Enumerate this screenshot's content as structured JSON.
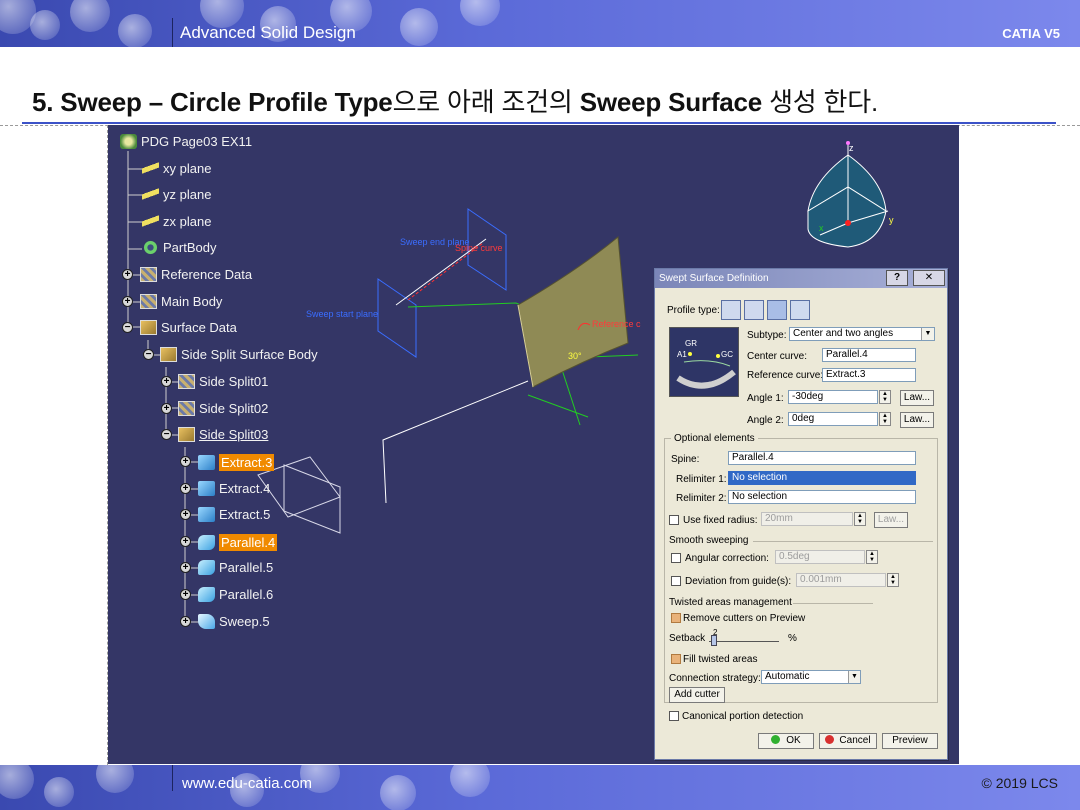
{
  "header": {
    "title": "Advanced Solid Design",
    "product": "CATIA V5"
  },
  "footer": {
    "url": "www.edu-catia.com",
    "copyright": "© 2019 LCS"
  },
  "slide": {
    "title_bold_1": "5. Sweep – Circle Profile Type",
    "title_kr_1": "으로 아래 조건의 ",
    "title_bold_2": "Sweep Surface",
    "title_kr_2": " 생성 한다."
  },
  "tree": {
    "root": "PDG Page03 EX11",
    "items": [
      {
        "label": "xy plane"
      },
      {
        "label": "yz plane"
      },
      {
        "label": "zx plane"
      },
      {
        "label": "PartBody"
      },
      {
        "label": "Reference Data"
      },
      {
        "label": "Main Body"
      },
      {
        "label": "Surface Data"
      },
      {
        "label": "Side Split Surface Body"
      },
      {
        "label": "Side Split01"
      },
      {
        "label": "Side Split02"
      },
      {
        "label": "Side Split03"
      },
      {
        "label": "Extract.3"
      },
      {
        "label": "Extract.4"
      },
      {
        "label": "Extract.5"
      },
      {
        "label": "Parallel.4"
      },
      {
        "label": "Parallel.5"
      },
      {
        "label": "Parallel.6"
      },
      {
        "label": "Sweep.5"
      }
    ]
  },
  "viewport_labels": {
    "sweep_end_plane": "Sweep end plane",
    "spine_curve": "Spine curve",
    "sweep_start_plane": "Sweep start plane",
    "reference": "Reference c",
    "angle": "30°",
    "compass_z": "z",
    "compass_y": "y",
    "compass_x": "x"
  },
  "dialog": {
    "title": "Swept Surface Definition",
    "help_button": "?",
    "close_button": "✕",
    "profile_type_label": "Profile type:",
    "subtype_label": "Subtype:",
    "subtype_value": "Center and two angles",
    "center_curve_label": "Center curve:",
    "center_curve_value": "Parallel.4",
    "reference_curve_label": "Reference curve:",
    "reference_curve_value": "Extract.3",
    "angle1_label": "Angle 1:",
    "angle1_value": "-30deg",
    "angle2_label": "Angle 2:",
    "angle2_value": "0deg",
    "law_button": "Law...",
    "preview_labels": {
      "gr": "GR",
      "gc": "GC",
      "a1": "A1"
    },
    "optional_elements": "Optional elements",
    "spine_label": "Spine:",
    "spine_value": "Parallel.4",
    "relimiter1_label": "Relimiter 1:",
    "relimiter1_value": "No selection",
    "relimiter2_label": "Relimiter 2:",
    "relimiter2_value": "No selection",
    "use_fixed_radius": "Use fixed radius:",
    "fixed_radius_value": "20mm",
    "law_button_disabled": "Law...",
    "smooth_sweeping": "Smooth sweeping",
    "angular_correction": "Angular correction:",
    "angular_correction_value": "0.5deg",
    "deviation_from_guides": "Deviation from guide(s):",
    "deviation_value": "0.001mm",
    "twisted_areas": "Twisted areas management",
    "remove_cutters": "Remove cutters on Preview",
    "setback_label": "Setback",
    "setback_value": "2",
    "setback_unit": "%",
    "fill_twisted": "Fill twisted areas",
    "connection_strategy_label": "Connection strategy:",
    "connection_strategy_value": "Automatic",
    "add_cutter": "Add cutter",
    "canonical_detection": "Canonical portion detection",
    "ok": "OK",
    "cancel": "Cancel",
    "preview": "Preview"
  }
}
